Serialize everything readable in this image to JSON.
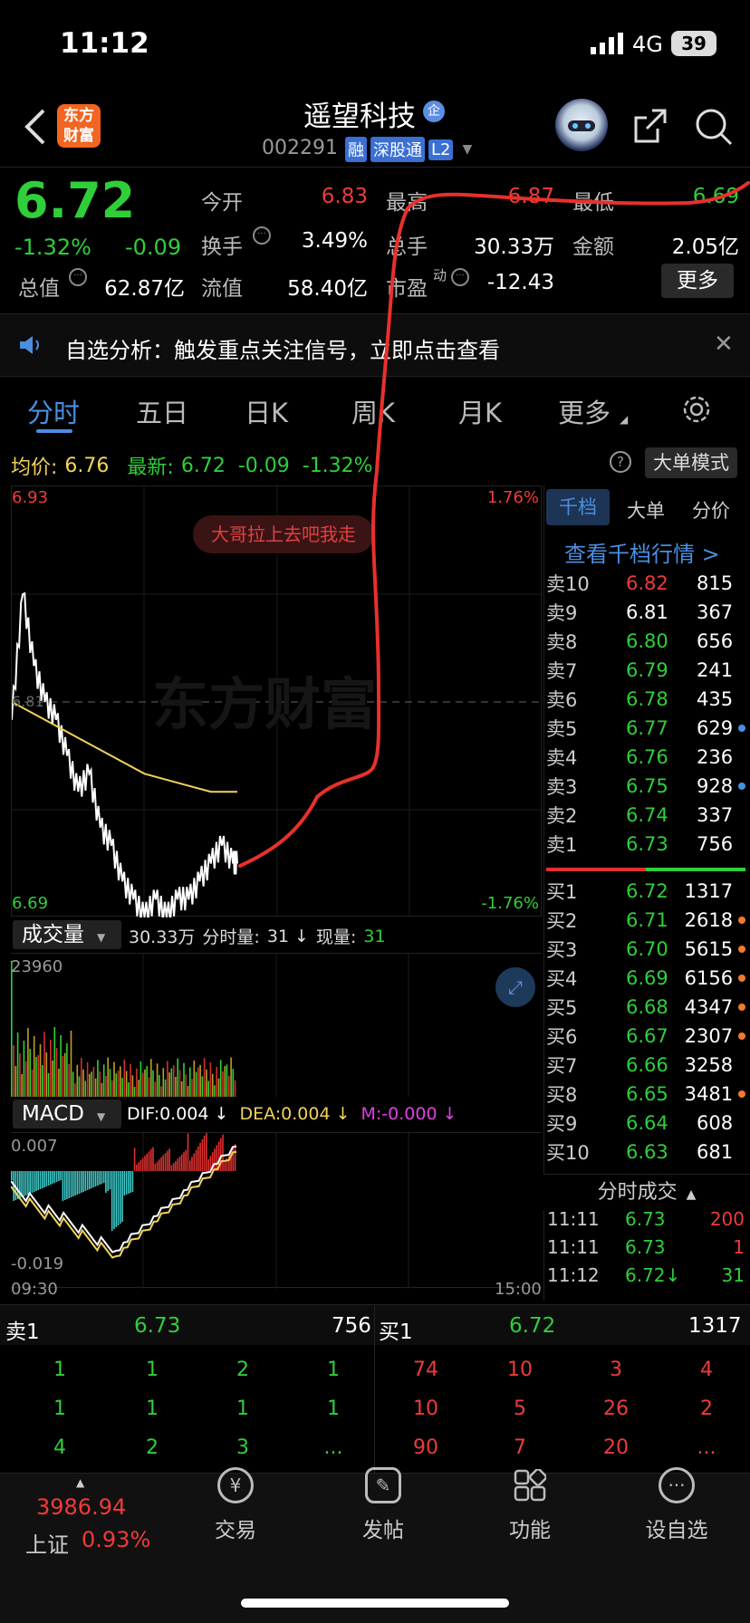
{
  "status_bar": {
    "time": "11:12",
    "network": "4G",
    "battery": "39"
  },
  "header": {
    "logo": "东方财富",
    "stock_name": "遥望科技",
    "badge": "企",
    "code": "002291",
    "tags": [
      "融",
      "深股通",
      "L2"
    ]
  },
  "quote": {
    "price": "6.72",
    "change_pct": "-1.32%",
    "change": "-0.09",
    "open_label": "今开",
    "open": "6.83",
    "high_label": "最高",
    "high": "6.87",
    "low_label": "最低",
    "low": "6.69",
    "turnover_label": "换手",
    "turnover": "3.49%",
    "volume_label": "总手",
    "volume": "30.33万",
    "amount_label": "金额",
    "amount": "2.05亿",
    "mktcap_label": "总值",
    "mktcap": "62.87亿",
    "float_label": "流值",
    "float": "58.40亿",
    "pe_label": "市盈",
    "pe_sup": "动",
    "pe": "-12.43",
    "more_button": "更多"
  },
  "notice": {
    "text": "自选分析：触发重点关注信号，立即点击查看"
  },
  "tabs": [
    "分时",
    "五日",
    "日K",
    "周K",
    "月K",
    "更多"
  ],
  "info_bar": {
    "avg_label": "均价:",
    "avg": "6.76",
    "latest_label": "最新:",
    "latest": "6.72",
    "latest_change": "-0.09",
    "latest_pct": "-1.32%",
    "big_mode_button": "大单模式"
  },
  "price_chart": {
    "top_price": "6.93",
    "bottom_price": "6.69",
    "top_pct": "1.76%",
    "bottom_pct": "-1.76%",
    "midline_label": "6.81",
    "bubble": "大哥拉上去吧我走",
    "watermark": "东方财富"
  },
  "volume_chart": {
    "selector": "成交量",
    "summary": "30.33万",
    "fenshi_label": "分时量:",
    "fenshi": "31 ↓",
    "now_label": "现量:",
    "now": "31",
    "max": "23960"
  },
  "macd_chart": {
    "selector": "MACD",
    "dif": "DIF:0.004 ↓",
    "dea": "DEA:0.004 ↓",
    "m": "M:-0.000 ↓",
    "top": "0.007",
    "bottom": "-0.019",
    "time_start": "09:30",
    "time_end": "15:00"
  },
  "orderbook": {
    "tabs": [
      "千档",
      "大单",
      "分价"
    ],
    "link": "查看千档行情 >",
    "sell": [
      {
        "label": "卖10",
        "price": "6.82",
        "vol": "815",
        "color": "red",
        "dot": ""
      },
      {
        "label": "卖9",
        "price": "6.81",
        "vol": "367",
        "color": "white",
        "dot": ""
      },
      {
        "label": "卖8",
        "price": "6.80",
        "vol": "656",
        "color": "green",
        "dot": ""
      },
      {
        "label": "卖7",
        "price": "6.79",
        "vol": "241",
        "color": "green",
        "dot": ""
      },
      {
        "label": "卖6",
        "price": "6.78",
        "vol": "435",
        "color": "green",
        "dot": ""
      },
      {
        "label": "卖5",
        "price": "6.77",
        "vol": "629",
        "color": "green",
        "dot": "#4a8fe0"
      },
      {
        "label": "卖4",
        "price": "6.76",
        "vol": "236",
        "color": "green",
        "dot": ""
      },
      {
        "label": "卖3",
        "price": "6.75",
        "vol": "928",
        "color": "green",
        "dot": "#4a8fe0"
      },
      {
        "label": "卖2",
        "price": "6.74",
        "vol": "337",
        "color": "green",
        "dot": ""
      },
      {
        "label": "卖1",
        "price": "6.73",
        "vol": "756",
        "color": "green",
        "dot": ""
      }
    ],
    "buy": [
      {
        "label": "买1",
        "price": "6.72",
        "vol": "1317",
        "color": "green",
        "dot": ""
      },
      {
        "label": "买2",
        "price": "6.71",
        "vol": "2618",
        "color": "green",
        "dot": "#f07a30"
      },
      {
        "label": "买3",
        "price": "6.70",
        "vol": "5615",
        "color": "green",
        "dot": "#f07a30"
      },
      {
        "label": "买4",
        "price": "6.69",
        "vol": "6156",
        "color": "green",
        "dot": "#f07a30"
      },
      {
        "label": "买5",
        "price": "6.68",
        "vol": "4347",
        "color": "green",
        "dot": "#f07a30"
      },
      {
        "label": "买6",
        "price": "6.67",
        "vol": "2307",
        "color": "green",
        "dot": "#f07a30"
      },
      {
        "label": "买7",
        "price": "6.66",
        "vol": "3258",
        "color": "green",
        "dot": ""
      },
      {
        "label": "买8",
        "price": "6.65",
        "vol": "3481",
        "color": "green",
        "dot": "#f07a30"
      },
      {
        "label": "买9",
        "price": "6.64",
        "vol": "608",
        "color": "green",
        "dot": ""
      },
      {
        "label": "买10",
        "price": "6.63",
        "vol": "681",
        "color": "green",
        "dot": ""
      }
    ],
    "trades_title": "分时成交",
    "trades": [
      {
        "time": "11:11",
        "price": "6.73",
        "vol": "200",
        "vcolor": "red"
      },
      {
        "time": "11:11",
        "price": "6.73",
        "vol": "1",
        "vcolor": "red"
      },
      {
        "time": "11:12",
        "price": "6.72↓",
        "vol": "31",
        "vcolor": "green"
      }
    ]
  },
  "queue": {
    "sell_label": "卖1",
    "sell_price": "6.73",
    "sell_vol": "756",
    "buy_label": "买1",
    "buy_price": "6.72",
    "buy_vol": "1317",
    "sell_rows": [
      [
        "1",
        "1",
        "2",
        "1"
      ],
      [
        "1",
        "1",
        "1",
        "1"
      ],
      [
        "4",
        "2",
        "3",
        "..."
      ]
    ],
    "buy_rows": [
      [
        "74",
        "10",
        "3",
        "4"
      ],
      [
        "10",
        "5",
        "26",
        "2"
      ],
      [
        "90",
        "7",
        "20",
        "..."
      ]
    ]
  },
  "bottom_nav": {
    "index_value": "3986.94",
    "index_name": "上证",
    "index_pct": "0.93%",
    "items": [
      "交易",
      "发帖",
      "功能",
      "设自选"
    ]
  },
  "chart_data": {
    "type": "line",
    "series": [
      {
        "name": "price",
        "x": [
          "09:30",
          "09:35",
          "09:40",
          "09:45",
          "09:50",
          "09:55",
          "10:00",
          "10:05",
          "10:10",
          "10:15",
          "10:20",
          "10:25",
          "10:30",
          "10:35",
          "10:40",
          "10:45",
          "10:50",
          "10:55",
          "11:00",
          "11:05",
          "11:10",
          "11:12"
        ],
        "values": [
          6.8,
          6.87,
          6.83,
          6.81,
          6.8,
          6.78,
          6.76,
          6.77,
          6.74,
          6.73,
          6.71,
          6.7,
          6.69,
          6.7,
          6.69,
          6.7,
          6.7,
          6.71,
          6.72,
          6.73,
          6.72,
          6.72
        ]
      },
      {
        "name": "avg",
        "x": [
          "09:30",
          "09:45",
          "10:00",
          "10:15",
          "10:30",
          "10:45",
          "11:00",
          "11:12"
        ],
        "values": [
          6.81,
          6.8,
          6.79,
          6.78,
          6.77,
          6.765,
          6.76,
          6.76
        ]
      }
    ],
    "ylim": [
      6.69,
      6.93
    ],
    "ylabel_right": [
      "1.76%",
      "-1.76%"
    ]
  }
}
